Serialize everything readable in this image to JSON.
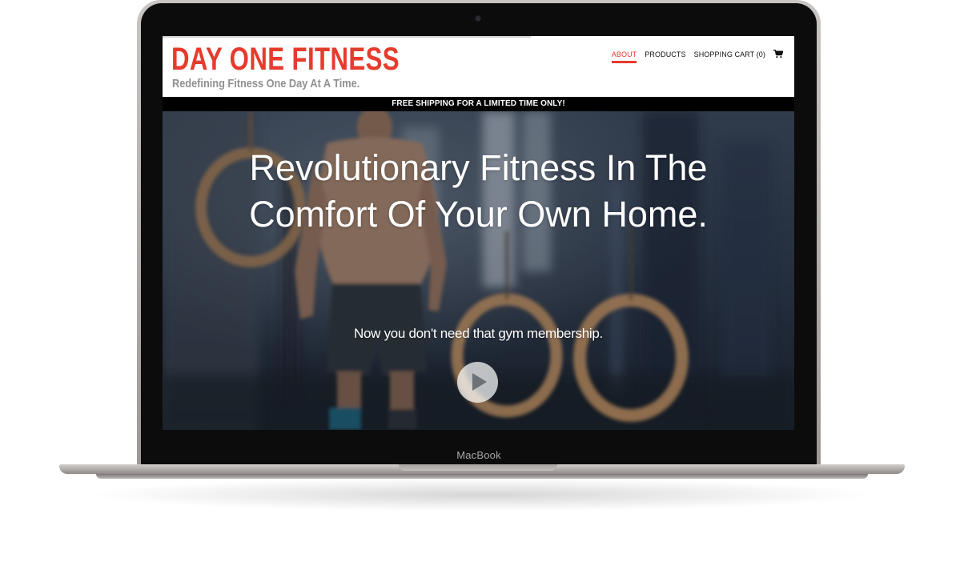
{
  "device": {
    "label": "MacBook"
  },
  "header": {
    "brand": "DAY ONE FITNESS",
    "tagline": "Redefining Fitness One Day At A Time."
  },
  "nav": {
    "items": [
      {
        "label": "ABOUT",
        "active": true
      },
      {
        "label": "PRODUCTS",
        "active": false
      },
      {
        "label": "SHOPPING CART (0)",
        "active": false
      }
    ],
    "cart_icon": "shopping-cart-icon"
  },
  "promo": {
    "text": "FREE SHIPPING FOR A LIMITED TIME ONLY!"
  },
  "hero": {
    "headline": "Revolutionary Fitness In The Comfort Of Your Own Home.",
    "subheadline": "Now you don't need that gym membership.",
    "play_icon": "play-icon"
  },
  "colors": {
    "accent": "#e63b2e",
    "tagline": "#909090",
    "promo_bg": "#000000",
    "hero_bg": "#24303f"
  }
}
